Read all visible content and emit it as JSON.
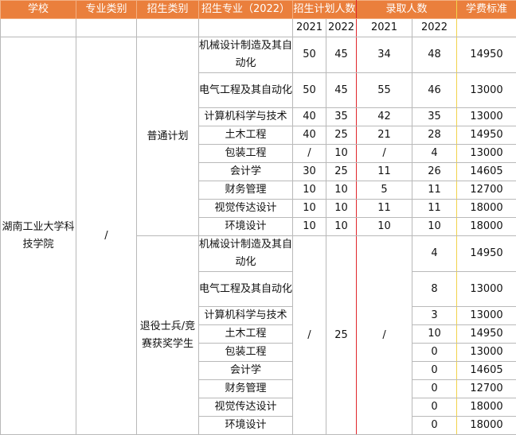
{
  "headers": {
    "school": "学校",
    "major_type": "专业类别",
    "enroll_type": "招生类别",
    "major": "招生专业（2022）",
    "plan": "招生计划人数",
    "admitted": "录取人数",
    "fee": "学费标准"
  },
  "years": {
    "y2021": "2021",
    "y2022": "2022"
  },
  "school_name": "湖南工业大学科技学院",
  "major_type_value": "/",
  "groups": [
    {
      "name": "普通计划",
      "rows": [
        {
          "major": "机械设计制造及其自动化",
          "plan2021": "50",
          "plan2022": "45",
          "adm2021": "34",
          "adm2022": "48",
          "fee": "14950"
        },
        {
          "major": "电气工程及其自动化",
          "plan2021": "50",
          "plan2022": "45",
          "adm2021": "55",
          "adm2022": "46",
          "fee": "13000"
        },
        {
          "major": "计算机科学与技术",
          "plan2021": "40",
          "plan2022": "35",
          "adm2021": "42",
          "adm2022": "35",
          "fee": "13000"
        },
        {
          "major": "土木工程",
          "plan2021": "40",
          "plan2022": "25",
          "adm2021": "21",
          "adm2022": "28",
          "fee": "14950"
        },
        {
          "major": "包装工程",
          "plan2021": "/",
          "plan2022": "10",
          "adm2021": "/",
          "adm2022": "4",
          "fee": "13000"
        },
        {
          "major": "会计学",
          "plan2021": "30",
          "plan2022": "25",
          "adm2021": "11",
          "adm2022": "26",
          "fee": "14605"
        },
        {
          "major": "财务管理",
          "plan2021": "10",
          "plan2022": "10",
          "adm2021": "5",
          "adm2022": "11",
          "fee": "12700"
        },
        {
          "major": "视觉传达设计",
          "plan2021": "10",
          "plan2022": "10",
          "adm2021": "11",
          "adm2022": "11",
          "fee": "18000"
        },
        {
          "major": "环境设计",
          "plan2021": "10",
          "plan2022": "10",
          "adm2021": "10",
          "adm2022": "10",
          "fee": "18000"
        }
      ]
    },
    {
      "name": "退役士兵/竞赛获奖学生",
      "plan2021": "/",
      "plan2022": "25",
      "adm2021": "/",
      "rows": [
        {
          "major": "机械设计制造及其自动化",
          "adm2022": "4",
          "fee": "14950"
        },
        {
          "major": "电气工程及其自动化",
          "adm2022": "8",
          "fee": "13000"
        },
        {
          "major": "计算机科学与技术",
          "adm2022": "3",
          "fee": "13000"
        },
        {
          "major": "土木工程",
          "adm2022": "10",
          "fee": "14950"
        },
        {
          "major": "包装工程",
          "adm2022": "0",
          "fee": "13000"
        },
        {
          "major": "会计学",
          "adm2022": "0",
          "fee": "14605"
        },
        {
          "major": "财务管理",
          "adm2022": "0",
          "fee": "12700"
        },
        {
          "major": "视觉传达设计",
          "adm2022": "0",
          "fee": "18000"
        },
        {
          "major": "环境设计",
          "adm2022": "0",
          "fee": "18000"
        }
      ]
    }
  ]
}
